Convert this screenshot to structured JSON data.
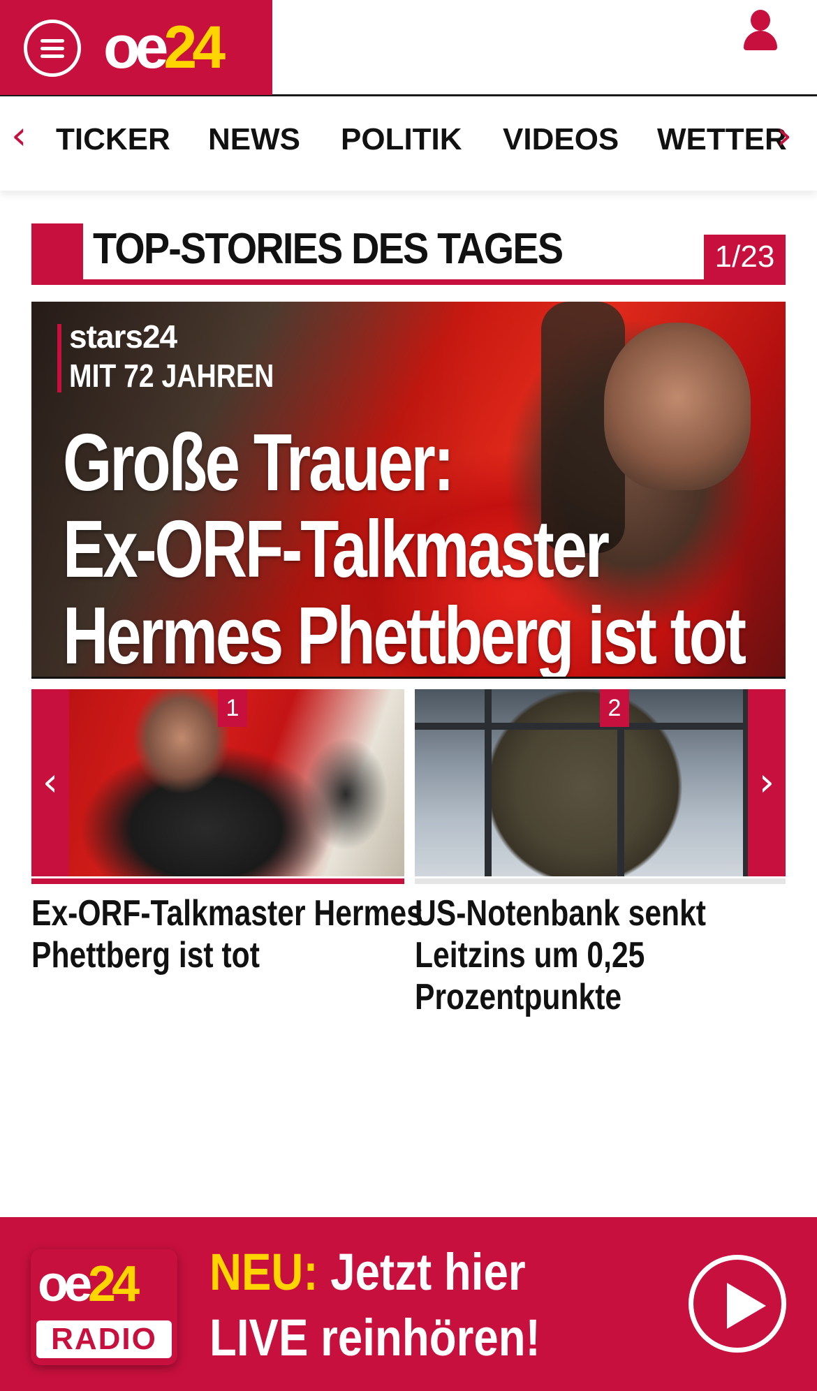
{
  "header": {
    "logo": {
      "part1": "oe",
      "part2": "24"
    },
    "menu_icon": "hamburger-menu-icon",
    "user_icon": "user-icon"
  },
  "nav": {
    "items": [
      "TICKER",
      "NEWS",
      "POLITIK",
      "VIDEOS",
      "WETTER"
    ],
    "prev_arrow": "‹",
    "next_arrow": "›"
  },
  "section": {
    "title": "TOP-STORIES DES TAGES",
    "counter": "1/23"
  },
  "hero": {
    "brand": "stars24",
    "kicker": "MIT 72 JAHREN",
    "headline_lines": [
      "Große Trauer:",
      "Ex-ORF-Talkmaster",
      "Hermes Phettberg ist tot"
    ]
  },
  "carousel": {
    "prev_arrow": "‹",
    "next_arrow": "›",
    "items": [
      {
        "badge": "1",
        "caption_lines": [
          "Ex-ORF-Talkmaster Hermes",
          "Phettberg ist tot"
        ]
      },
      {
        "badge": "2",
        "caption_lines": [
          "US-Notenbank senkt",
          "Leitzins um 0,25",
          "Prozentpunkte"
        ]
      }
    ]
  },
  "radio_banner": {
    "logo": {
      "part1": "oe",
      "part2": "24",
      "label": "RADIO"
    },
    "neu": "NEU:",
    "line1_rest": " Jetzt hier",
    "line2": "LIVE reinhören!",
    "play_icon": "play-icon"
  },
  "colors": {
    "brand_red": "#c8103e",
    "brand_yellow": "#ffd500",
    "text_dark": "#111111"
  }
}
